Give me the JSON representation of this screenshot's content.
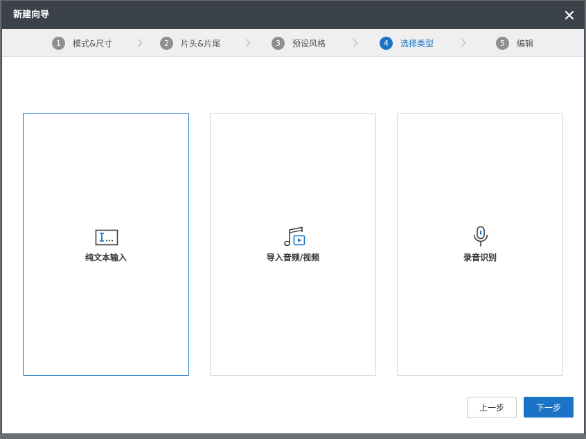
{
  "dialog": {
    "title": "新建向导",
    "close_icon": "close-icon"
  },
  "steps": [
    {
      "number": "1",
      "label": "模式&尺寸",
      "active": false
    },
    {
      "number": "2",
      "label": "片头&片尾",
      "active": false
    },
    {
      "number": "3",
      "label": "预设风格",
      "active": false
    },
    {
      "number": "4",
      "label": "选择类型",
      "active": true
    },
    {
      "number": "5",
      "label": "编辑",
      "active": false
    }
  ],
  "types": [
    {
      "label": "纯文本输入",
      "icon": "text-input-icon",
      "selected": true
    },
    {
      "label": "导入音频/视频",
      "icon": "music-video-icon",
      "selected": false
    },
    {
      "label": "录音识别",
      "icon": "microphone-icon",
      "selected": false
    }
  ],
  "buttons": {
    "prev_label": "上一步",
    "next_label": "下一步"
  },
  "colors": {
    "accent": "#1a73c6",
    "titlebar": "#3b424a",
    "step_inactive": "#8f8f8f"
  }
}
